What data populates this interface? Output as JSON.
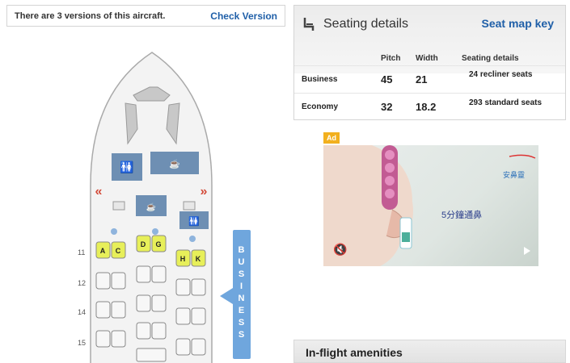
{
  "versions": {
    "text": "There are 3 versions of this aircraft.",
    "link": "Check Version"
  },
  "seating": {
    "title": "Seating details",
    "key_link": "Seat map key",
    "columns": [
      "Pitch",
      "Width",
      "Seating details"
    ],
    "rows": [
      {
        "class": "Business",
        "pitch": "45",
        "width": "21",
        "details": "24 recliner seats"
      },
      {
        "class": "Economy",
        "pitch": "32",
        "width": "18.2",
        "details": "293 standard seats"
      }
    ]
  },
  "ad": {
    "badge": "Ad",
    "brand": "安鼻靈",
    "caption": "5分鐘通鼻"
  },
  "amenities": {
    "title": "In-flight amenities"
  },
  "seatmap": {
    "cabin_label": "BUSINESS",
    "rows": [
      "11",
      "12",
      "14",
      "15"
    ],
    "row11_seats": [
      "A",
      "C",
      "D",
      "G",
      "H",
      "K"
    ]
  },
  "colors": {
    "link": "#1f5fa8",
    "cabin_tab": "#6fa6dd",
    "exit": "#d34b3a",
    "seat_highlight": "#e7ef59"
  }
}
